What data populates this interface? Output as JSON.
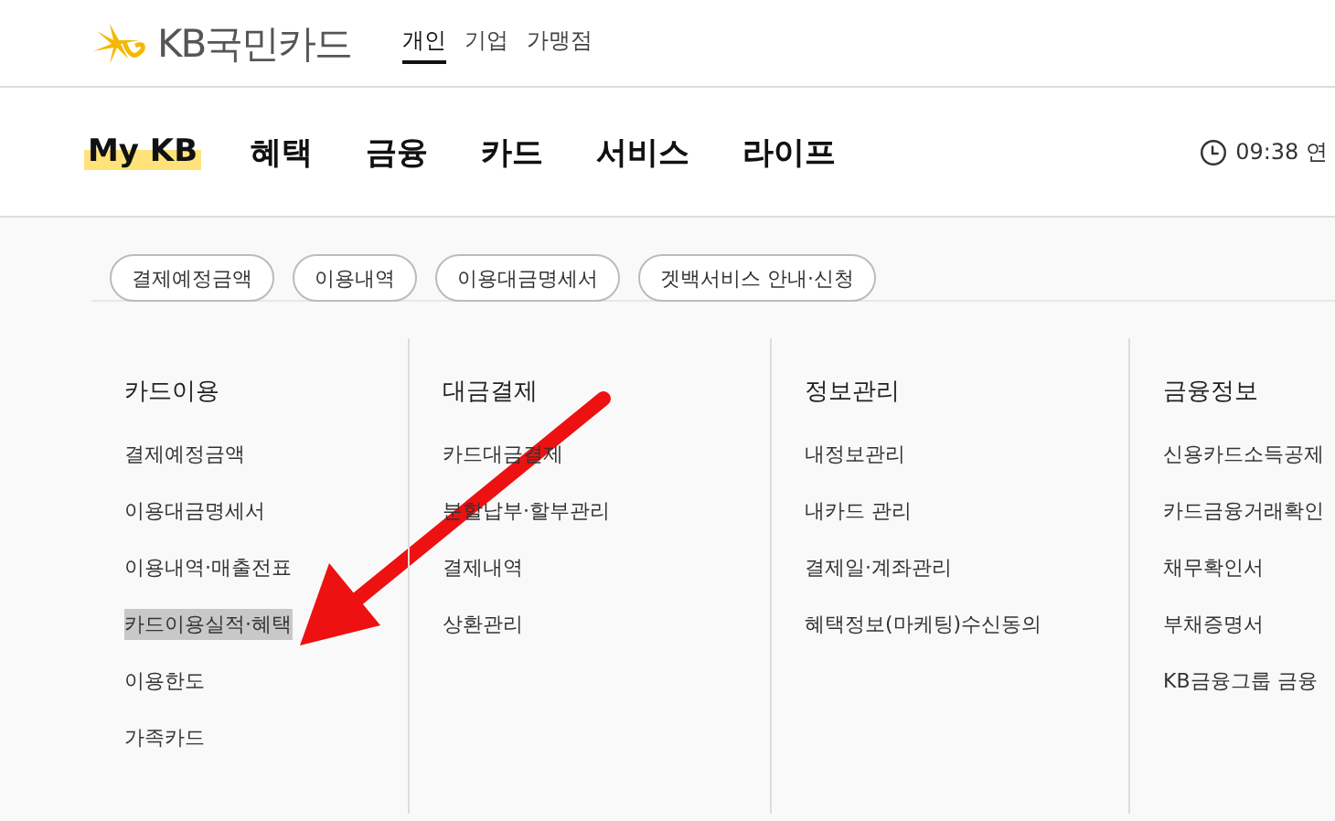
{
  "logo": {
    "text": "KB국민카드"
  },
  "audience_tabs": [
    {
      "label": "개인",
      "selected": true
    },
    {
      "label": "기업",
      "selected": false
    },
    {
      "label": "가맹점",
      "selected": false
    }
  ],
  "nav": [
    {
      "label": "My KB",
      "selected": true
    },
    {
      "label": "혜택",
      "selected": false
    },
    {
      "label": "금융",
      "selected": false
    },
    {
      "label": "카드",
      "selected": false
    },
    {
      "label": "서비스",
      "selected": false
    },
    {
      "label": "라이프",
      "selected": false
    }
  ],
  "clock": {
    "time": "09:38 연"
  },
  "quick_links": [
    "결제예정금액",
    "이용내역",
    "이용대금명세서",
    "겟백서비스 안내·신청"
  ],
  "menu_columns": [
    {
      "title": "카드이용",
      "items": [
        {
          "label": "결제예정금액",
          "selected": false
        },
        {
          "label": "이용대금명세서",
          "selected": false
        },
        {
          "label": "이용내역·매출전표",
          "selected": false
        },
        {
          "label": "카드이용실적·혜택",
          "selected": true
        },
        {
          "label": "이용한도",
          "selected": false
        },
        {
          "label": "가족카드",
          "selected": false
        }
      ]
    },
    {
      "title": "대금결제",
      "items": [
        {
          "label": "카드대금결제",
          "selected": false
        },
        {
          "label": "분할납부·할부관리",
          "selected": false
        },
        {
          "label": "결제내역",
          "selected": false
        },
        {
          "label": "상환관리",
          "selected": false
        }
      ]
    },
    {
      "title": "정보관리",
      "items": [
        {
          "label": "내정보관리",
          "selected": false
        },
        {
          "label": "내카드 관리",
          "selected": false
        },
        {
          "label": "결제일·계좌관리",
          "selected": false
        },
        {
          "label": "혜택정보(마케팅)수신동의",
          "selected": false
        }
      ]
    },
    {
      "title": "금융정보",
      "items": [
        {
          "label": "신용카드소득공제",
          "selected": false
        },
        {
          "label": "카드금융거래확인",
          "selected": false
        },
        {
          "label": "채무확인서",
          "selected": false
        },
        {
          "label": "부채증명서",
          "selected": false
        },
        {
          "label": "KB금융그룹 금융",
          "selected": false
        }
      ]
    }
  ]
}
